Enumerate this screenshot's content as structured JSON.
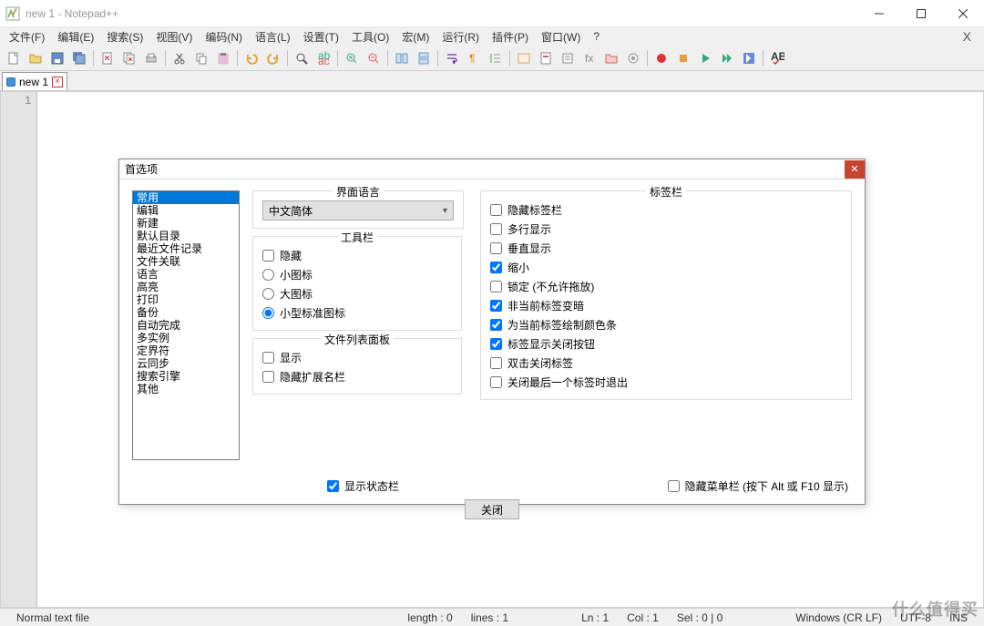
{
  "window": {
    "title": "new 1 - Notepad++"
  },
  "menu": {
    "items": [
      "文件(F)",
      "编辑(E)",
      "搜索(S)",
      "视图(V)",
      "编码(N)",
      "语言(L)",
      "设置(T)",
      "工具(O)",
      "宏(M)",
      "运行(R)",
      "插件(P)",
      "窗口(W)"
    ],
    "help": "?"
  },
  "tab": {
    "name": "new 1"
  },
  "gutter": {
    "line1": "1"
  },
  "status": {
    "filetype": "Normal text file",
    "length": "length : 0",
    "lines": "lines : 1",
    "ln": "Ln : 1",
    "col": "Col : 1",
    "sel": "Sel : 0 | 0",
    "eol": "Windows (CR LF)",
    "enc": "UTF-8",
    "ins": "INS"
  },
  "dialog": {
    "title": "首选项",
    "close_btn": "关闭",
    "categories": [
      "常用",
      "编辑",
      "新建",
      "默认目录",
      "最近文件记录",
      "文件关联",
      "语言",
      "高亮",
      "打印",
      "备份",
      "自动完成",
      "多实例",
      "定界符",
      "云同步",
      "搜索引擎",
      "其他"
    ],
    "lang_group": "界面语言",
    "lang_value": "中文简体",
    "toolbar_group": "工具栏",
    "toolbar_hide": "隐藏",
    "toolbar_small": "小图标",
    "toolbar_big": "大图标",
    "toolbar_std": "小型标准图标",
    "doclist_group": "文件列表面板",
    "doclist_show": "显示",
    "doclist_hideext": "隐藏扩展名栏",
    "show_status": "显示状态栏",
    "tabbar_group": "标签栏",
    "tb_hide": "隐藏标签栏",
    "tb_multi": "多行显示",
    "tb_vert": "垂直显示",
    "tb_small": "缩小",
    "tb_lock": "锁定 (不允许拖放)",
    "tb_inactive": "非当前标签变暗",
    "tb_colorbar": "为当前标签绘制颜色条",
    "tb_closebtn": "标签显示关闭按钮",
    "tb_dblclose": "双击关闭标签",
    "tb_lastexit": "关闭最后一个标签时退出",
    "hide_menu": "隐藏菜单栏 (按下 Alt 或 F10 显示)"
  },
  "watermark": "什么值得买"
}
